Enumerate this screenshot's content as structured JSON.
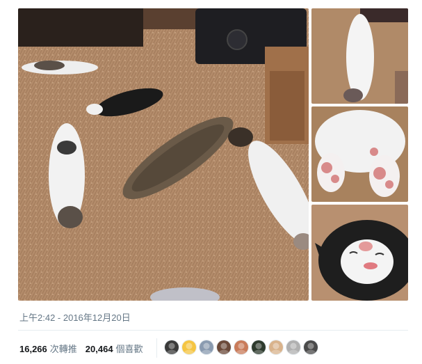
{
  "tweet": {
    "timestamp": "上午2:42 - 2016年12月20日",
    "retweets": {
      "count": "16,266",
      "label": "次轉推"
    },
    "likes": {
      "count": "20,464",
      "label": "個喜歡"
    }
  },
  "media": {
    "photos": [
      {
        "name": "cats-sleeping-on-rug-photo"
      },
      {
        "name": "white-cat-belly-up-photo"
      },
      {
        "name": "cat-paw-pads-photo"
      },
      {
        "name": "black-white-cat-face-photo"
      }
    ]
  },
  "liker_avatars": [
    {
      "name": "liker-avatar-1",
      "color": "#3a3a3a"
    },
    {
      "name": "liker-avatar-2",
      "color": "#f5c542"
    },
    {
      "name": "liker-avatar-3",
      "color": "#8a9bb0"
    },
    {
      "name": "liker-avatar-4",
      "color": "#6b4a3a"
    },
    {
      "name": "liker-avatar-5",
      "color": "#c97b5a"
    },
    {
      "name": "liker-avatar-6",
      "color": "#2e3b2e"
    },
    {
      "name": "liker-avatar-7",
      "color": "#d9b38c"
    },
    {
      "name": "liker-avatar-8",
      "color": "#b0b0b0"
    },
    {
      "name": "liker-avatar-9",
      "color": "#4a4a4a"
    }
  ]
}
